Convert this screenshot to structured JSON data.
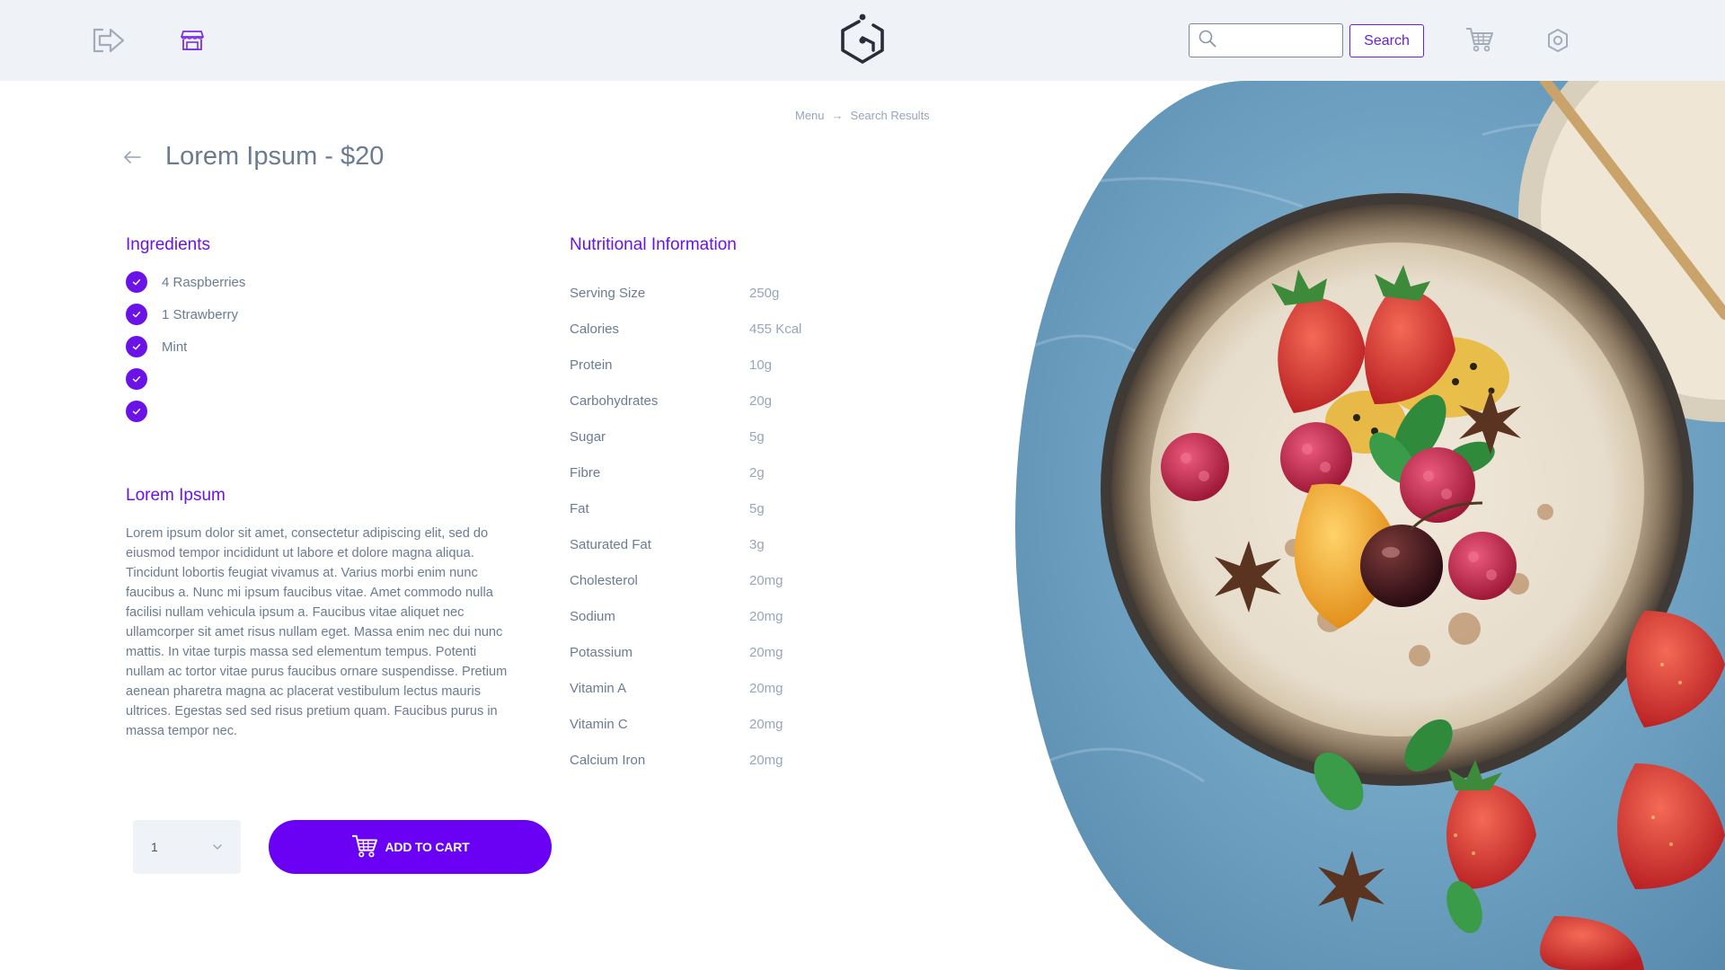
{
  "header": {
    "search_placeholder": "",
    "search_button_label": "Search",
    "icons": [
      "logout-icon",
      "store-icon",
      "logo-icon",
      "search-icon",
      "cart-icon",
      "gear-icon"
    ]
  },
  "breadcrumb": {
    "items": [
      "Menu",
      "Search Results"
    ]
  },
  "product": {
    "title": "Lorem Ipsum - $20"
  },
  "ingredients": {
    "heading": "Ingredients",
    "items": [
      "4 Raspberries",
      "1 Strawberry",
      "Mint",
      "",
      ""
    ]
  },
  "about": {
    "heading": "Lorem Ipsum",
    "text": "Lorem ipsum dolor sit amet, consectetur adipiscing elit, sed do eiusmod tempor incididunt ut labore et dolore magna aliqua. Tincidunt lobortis feugiat vivamus at. Varius morbi enim nunc faucibus a. Nunc mi ipsum faucibus vitae. Amet commodo nulla facilisi nullam vehicula ipsum a. Faucibus vitae aliquet nec ullamcorper sit amet risus nullam eget. Massa enim nec dui nunc mattis. In vitae turpis massa sed elementum tempus. Potenti nullam ac tortor vitae purus faucibus ornare suspendisse. Pretium aenean pharetra magna ac placerat vestibulum lectus mauris ultrices. Egestas sed sed risus pretium quam. Faucibus purus in massa tempor nec."
  },
  "nutrition": {
    "heading": "Nutritional Information",
    "rows": [
      {
        "label": "Serving Size",
        "value": "250g"
      },
      {
        "label": "Calories",
        "value": "455 Kcal"
      },
      {
        "label": "Protein",
        "value": "10g"
      },
      {
        "label": "Carbohydrates",
        "value": "20g"
      },
      {
        "label": "Sugar",
        "value": "5g"
      },
      {
        "label": "Fibre",
        "value": "2g"
      },
      {
        "label": "Fat",
        "value": "5g"
      },
      {
        "label": "Saturated Fat",
        "value": "3g"
      },
      {
        "label": "Cholesterol",
        "value": "20mg"
      },
      {
        "label": "Sodium",
        "value": "20mg"
      },
      {
        "label": "Potassium",
        "value": "20mg"
      },
      {
        "label": "Vitamin A",
        "value": "20mg"
      },
      {
        "label": "Vitamin C",
        "value": "20mg"
      },
      {
        "label": "Calcium Iron",
        "value": "20mg"
      }
    ]
  },
  "cart": {
    "quantity": "1",
    "add_label": "ADD TO CART"
  },
  "colors": {
    "accent": "#6a00f4",
    "heading": "#6a12e8",
    "header_bg": "#eff2f7"
  }
}
